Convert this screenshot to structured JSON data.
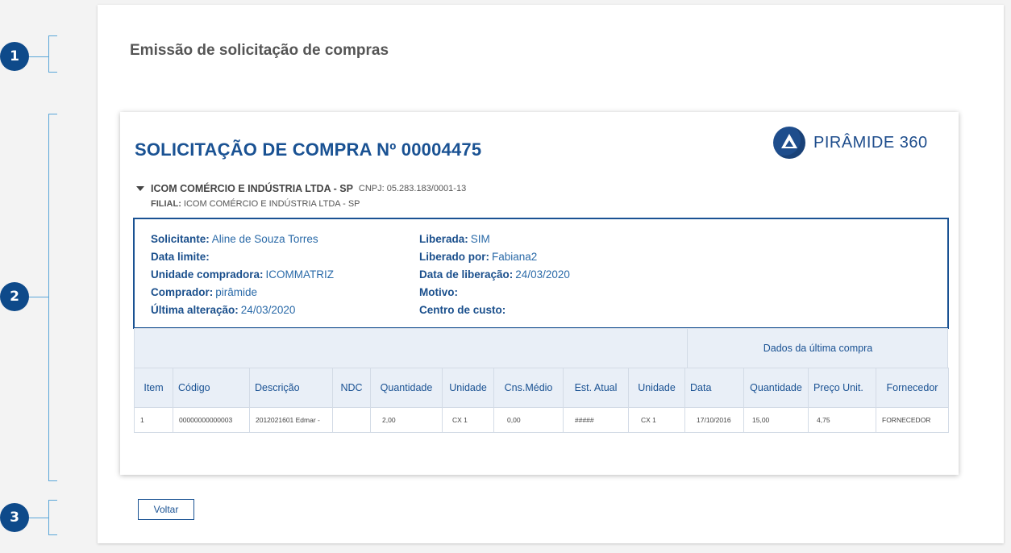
{
  "markers": [
    "1",
    "2",
    "3"
  ],
  "page_title": "Emissão de solicitação de compras",
  "document": {
    "title": "SOLICITAÇÃO DE COMPRA Nº 00004475",
    "logo_text": "PIRÂMIDE 360",
    "company": "ICOM COMÉRCIO E INDÚSTRIA LTDA - SP",
    "cnpj_label": "CNPJ:",
    "cnpj": "05.283.183/0001-13",
    "filial_label": "FILIAL:",
    "filial": "ICOM COMÉRCIO E INDÚSTRIA LTDA - SP"
  },
  "info_left": [
    {
      "label": "Solicitante:",
      "value": "Aline de Souza Torres"
    },
    {
      "label": "Data limite:",
      "value": ""
    },
    {
      "label": "Unidade compradora:",
      "value": "ICOMMATRIZ"
    },
    {
      "label": "Comprador:",
      "value": "pirâmide"
    },
    {
      "label": "Última alteração:",
      "value": "24/03/2020"
    }
  ],
  "info_right": [
    {
      "label": "Liberada:",
      "value": "SIM"
    },
    {
      "label": "Liberado por:",
      "value": "Fabiana2"
    },
    {
      "label": "Data de liberação:",
      "value": "24/03/2020"
    },
    {
      "label": "Motivo:",
      "value": ""
    },
    {
      "label": "Centro de custo:",
      "value": ""
    }
  ],
  "table": {
    "group_header": "Dados da última compra",
    "columns": [
      "Item",
      "Código",
      "Descrição",
      "NDC",
      "Quantidade",
      "Unidade",
      "Cns.Médio",
      "Est. Atual",
      "Unidade",
      "Data",
      "Quantidade",
      "Preço Unit.",
      "Fornecedor"
    ],
    "rows": [
      [
        "1",
        "00000000000003",
        "2012021601 Edmar -",
        "",
        "2,00",
        "CX 1",
        "0,00",
        "#####",
        "CX 1",
        "17/10/2016",
        "15,00",
        "4,75",
        "FORNECEDOR"
      ]
    ]
  },
  "back_button": "Voltar",
  "colors": {
    "primary": "#1a5293",
    "marker": "#0e4a8a",
    "bracket": "#5aa6d8",
    "header_bg": "#e9eff7"
  }
}
